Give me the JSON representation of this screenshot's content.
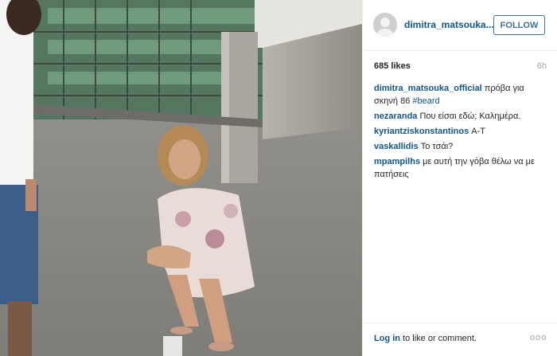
{
  "post": {
    "username_short": "dimitra_matsouka...",
    "follow_label": "FOLLOW",
    "likes": "685 likes",
    "time": "6h",
    "comments": [
      {
        "user": "dimitra_matsouka_official",
        "text": " πρόβα για σκηνή 86 ",
        "hashtag": "#beard"
      },
      {
        "user": "nezaranda",
        "text": " Που είσαι εδώ; Καλημέρα."
      },
      {
        "user": "kyriantziskonstantinos",
        "text": " Α-Τ"
      },
      {
        "user": "vaskallidis",
        "text": " Το τσάι?"
      },
      {
        "user": "mpampilhs",
        "text": " με αυτή την γόβα θέλω να με πατήσεις"
      }
    ],
    "login_link": "Log in",
    "login_rest": " to like or comment.",
    "more_label": "ooo"
  },
  "colors": {
    "link": "#125688",
    "follow": "#3f729b",
    "muted": "#a5a7aa"
  },
  "icons": {
    "more": "ellipsis-icon"
  }
}
